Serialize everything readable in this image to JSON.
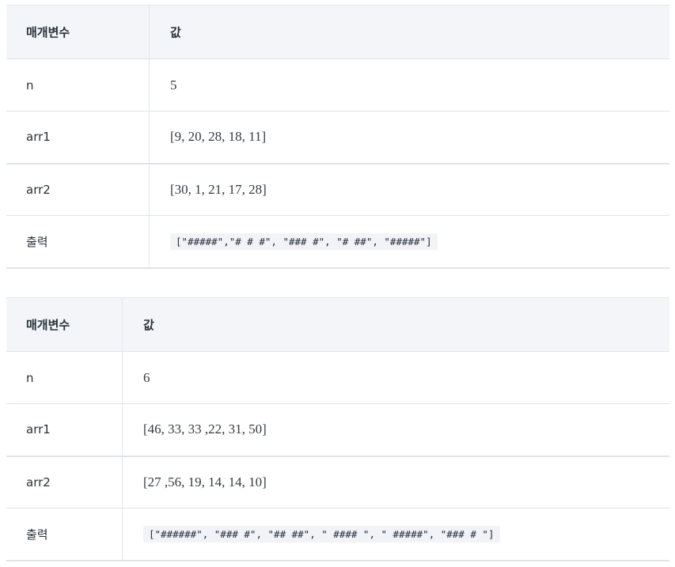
{
  "tables": [
    {
      "header": {
        "param": "매개변수",
        "value": "값"
      },
      "rows": [
        {
          "param": "n",
          "value": "5"
        },
        {
          "param": "arr1",
          "value": "[9, 20, 28, 18, 11]"
        },
        {
          "param": "arr2",
          "value": "[30, 1, 21, 17, 28]"
        },
        {
          "param": "출력",
          "value": "[\"#####\",\"# # #\", \"### #\", \"# ##\", \"#####\"]"
        }
      ]
    },
    {
      "header": {
        "param": "매개변수",
        "value": "값"
      },
      "rows": [
        {
          "param": "n",
          "value": "6"
        },
        {
          "param": "arr1",
          "value": "[46, 33, 33 ,22, 31, 50]"
        },
        {
          "param": "arr2",
          "value": "[27 ,56, 19, 14, 14, 10]"
        },
        {
          "param": "출력",
          "value": "[\"######\", \"### #\", \"## ##\", \" #### \", \" #####\", \"### # \"]"
        }
      ]
    }
  ]
}
